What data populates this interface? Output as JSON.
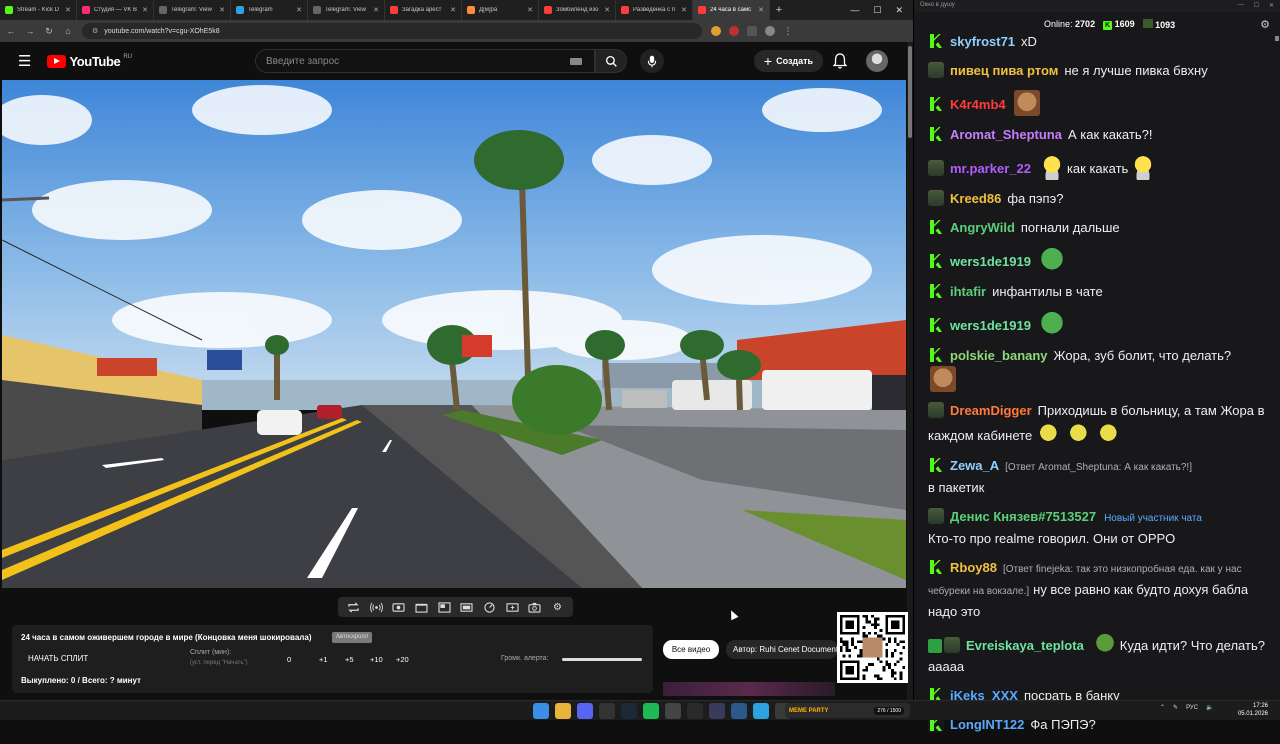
{
  "browser": {
    "tabs": [
      {
        "label": "Stream - Kick D",
        "color": "#53fc18",
        "active": false
      },
      {
        "label": "Студия — VK В",
        "color": "#ff2b6e",
        "active": false
      },
      {
        "label": "Telegram: View",
        "color": "#666666",
        "active": false
      },
      {
        "label": "Telegram",
        "color": "#2aa3e0",
        "active": false
      },
      {
        "label": "Telegram: View",
        "color": "#666666",
        "active": false
      },
      {
        "label": "Загадка арест",
        "color": "#ff3b3b",
        "active": false
      },
      {
        "label": "Д[м]ра",
        "color": "#ff8a3b",
        "active": false
      },
      {
        "label": "Зомбиленд изо",
        "color": "#ff3b3b",
        "active": false
      },
      {
        "label": "Разведенка с п",
        "color": "#ff3b3b",
        "active": false
      },
      {
        "label": "24 часа в самс",
        "color": "#ff3b3b",
        "active": true
      }
    ],
    "url": "youtube.com/watch?v=cgu-XOhE5k8"
  },
  "youtube": {
    "logo_text": "YouTube",
    "region": "RU",
    "search_placeholder": "Введите запрос",
    "create_label": "Создать",
    "all_videos_label": "Все видео",
    "author_label": "Автор: Ruhi Cenet Documentaries"
  },
  "overlay": {
    "video_title": "24 часа в самом оживершем городе в мире (Концовка меня шокировала)",
    "autoscroll_label": "Автоскролл",
    "start_split_label": "НАЧАТЬ СПЛИТ",
    "split_label": "Сплит (мин):",
    "split_sub": "(уст. перед \"Начать\")",
    "split_values": [
      "0",
      "+1",
      "+5",
      "+10",
      "+20"
    ],
    "alert_volume_label": "Громк. алерта:",
    "alert_volume_level": 1.0,
    "redeemed_text": "Выкуплено: 0 / Всего: ? минут"
  },
  "chat": {
    "window_title": "Окно в душу",
    "online_label": "Online:",
    "online_count": "2702",
    "stat_a": "1609",
    "stat_b": "1093",
    "messages": [
      {
        "badges": [
          "kick"
        ],
        "user": "skyfrost71",
        "color": "#8fd0ff",
        "text": "xD"
      },
      {
        "badges": [
          "sub"
        ],
        "user": "пивец пива ртом",
        "color": "#f0c040",
        "text": "не я лучше пивка бвхну"
      },
      {
        "badges": [
          "kick"
        ],
        "user": "K4r4mb4",
        "color": "#ff3b3b",
        "text": "",
        "emotes": [
          "face"
        ]
      },
      {
        "badges": [
          "kick"
        ],
        "user": "Aromat_Sheptuna",
        "color": "#c77dff",
        "text": "А как какать?!"
      },
      {
        "badges": [
          "sub"
        ],
        "user": "mr.parker_22",
        "color": "#b15cff",
        "text": "как какать",
        "emotes_before": [
          "ghost"
        ],
        "emotes": [
          "ghost"
        ]
      },
      {
        "badges": [
          "sub"
        ],
        "user": "Kreed86",
        "color": "#f0c040",
        "text": "фа пэпэ?"
      },
      {
        "badges": [
          "kick"
        ],
        "user": "AngryWild",
        "color": "#5ccf7a",
        "text": "погнали дальше"
      },
      {
        "badges": [
          "kick"
        ],
        "user": "wers1de1919",
        "color": "#6fe3a0",
        "text": "",
        "emotes": [
          "frog"
        ]
      },
      {
        "badges": [
          "kick"
        ],
        "user": "ihtafir",
        "color": "#5ccf7a",
        "text": "инфантилы в чате"
      },
      {
        "badges": [
          "kick"
        ],
        "user": "wers1de1919",
        "color": "#6fe3a0",
        "text": "",
        "emotes": [
          "frog"
        ]
      },
      {
        "badges": [
          "kick"
        ],
        "user": "polskie_banany",
        "color": "#8fd97a",
        "text": "Жора, зуб болит, что делать?",
        "emotes_after_line": [
          "face"
        ]
      },
      {
        "badges": [
          "sub"
        ],
        "user": "DreamDigger",
        "color": "#ff7a3b",
        "text": "Приходишь в больницу, а там Жора в каждом кабинете",
        "emotes": [
          "lemon",
          "lemon",
          "lemon"
        ]
      },
      {
        "badges": [
          "kick"
        ],
        "user": "Zewa_A",
        "color": "#8fd0ff",
        "reply": "[Ответ Aromat_Sheptuna: А как какать?!]",
        "text": "в пакетик"
      },
      {
        "badges": [
          "sub"
        ],
        "user": "Денис Князев#7513527",
        "color": "#5ccf7a",
        "newflag": "Новый участник чата",
        "text": "Кто-то про realme говорил. Они от OPPO"
      },
      {
        "badges": [
          "kick"
        ],
        "user": "Rboy88",
        "color": "#f0c040",
        "reply": "[Ответ finejeka: так это низкопробная еда. как у нас чебуреки на вокзале.]",
        "text": "ну все равно как будто дохуя бабла надо это"
      },
      {
        "badges": [
          "check",
          "sub"
        ],
        "user": "Evreiskaya_teplota",
        "color": "#6fe3a0",
        "text": "Куда идти? Что делать? ааааа",
        "emotes_before": [
          "blob"
        ]
      },
      {
        "badges": [
          "kick"
        ],
        "user": "iKeks_XXX",
        "color": "#5aa9ff",
        "text": "посрать в банку"
      },
      {
        "badges": [
          "kick"
        ],
        "user": "LongINT122",
        "color": "#5aa9ff",
        "text": "Фа ПЭПЭ?"
      }
    ]
  },
  "taskbar": {
    "stream_logo": "MEME PARTY",
    "stream_count": "276 / 1500",
    "lang": "РУС",
    "time": "17:26",
    "date": "05.01.2026"
  }
}
